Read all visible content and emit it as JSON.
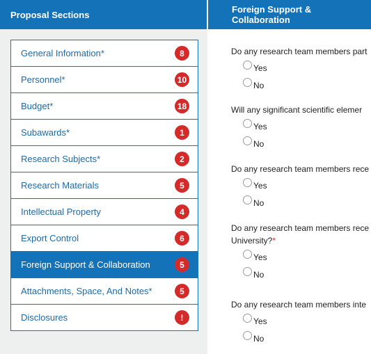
{
  "left_panel": {
    "title": "Proposal Sections",
    "sections": [
      {
        "label": "General Information*",
        "badge": "8"
      },
      {
        "label": "Personnel*",
        "badge": "10"
      },
      {
        "label": "Budget*",
        "badge": "18"
      },
      {
        "label": "Subawards*",
        "badge": "1"
      },
      {
        "label": "Research Subjects*",
        "badge": "2"
      },
      {
        "label": "Research Materials",
        "badge": "5"
      },
      {
        "label": "Intellectual Property",
        "badge": "4"
      },
      {
        "label": "Export Control",
        "badge": "6"
      },
      {
        "label": "Foreign Support & Collaboration",
        "badge": "5",
        "active": true
      },
      {
        "label": "Attachments, Space, And Notes*",
        "badge": "5"
      },
      {
        "label": "Disclosures",
        "badge": "!"
      }
    ]
  },
  "right_panel": {
    "title": "Foreign Support & Collaboration",
    "questions": [
      {
        "text": "Do any research team members part",
        "required_mark": "",
        "options": [
          "Yes",
          "No"
        ]
      },
      {
        "text": "Will any significant scientific elemer",
        "required_mark": "",
        "options": [
          "Yes",
          "No"
        ]
      },
      {
        "text": "Do any research team members rece",
        "required_mark": "",
        "options": [
          "Yes",
          "No"
        ]
      },
      {
        "text": "Do any research team members rece",
        "text_line2": "University?",
        "required_mark": "*",
        "options": [
          "Yes",
          "No"
        ]
      },
      {
        "text": "Do any research team members inte",
        "required_mark": "",
        "options": [
          "Yes",
          "No"
        ]
      }
    ]
  },
  "colors": {
    "primary": "#1473b8",
    "badge": "#d42a2a",
    "sidebar_bg": "#eef0f0"
  }
}
